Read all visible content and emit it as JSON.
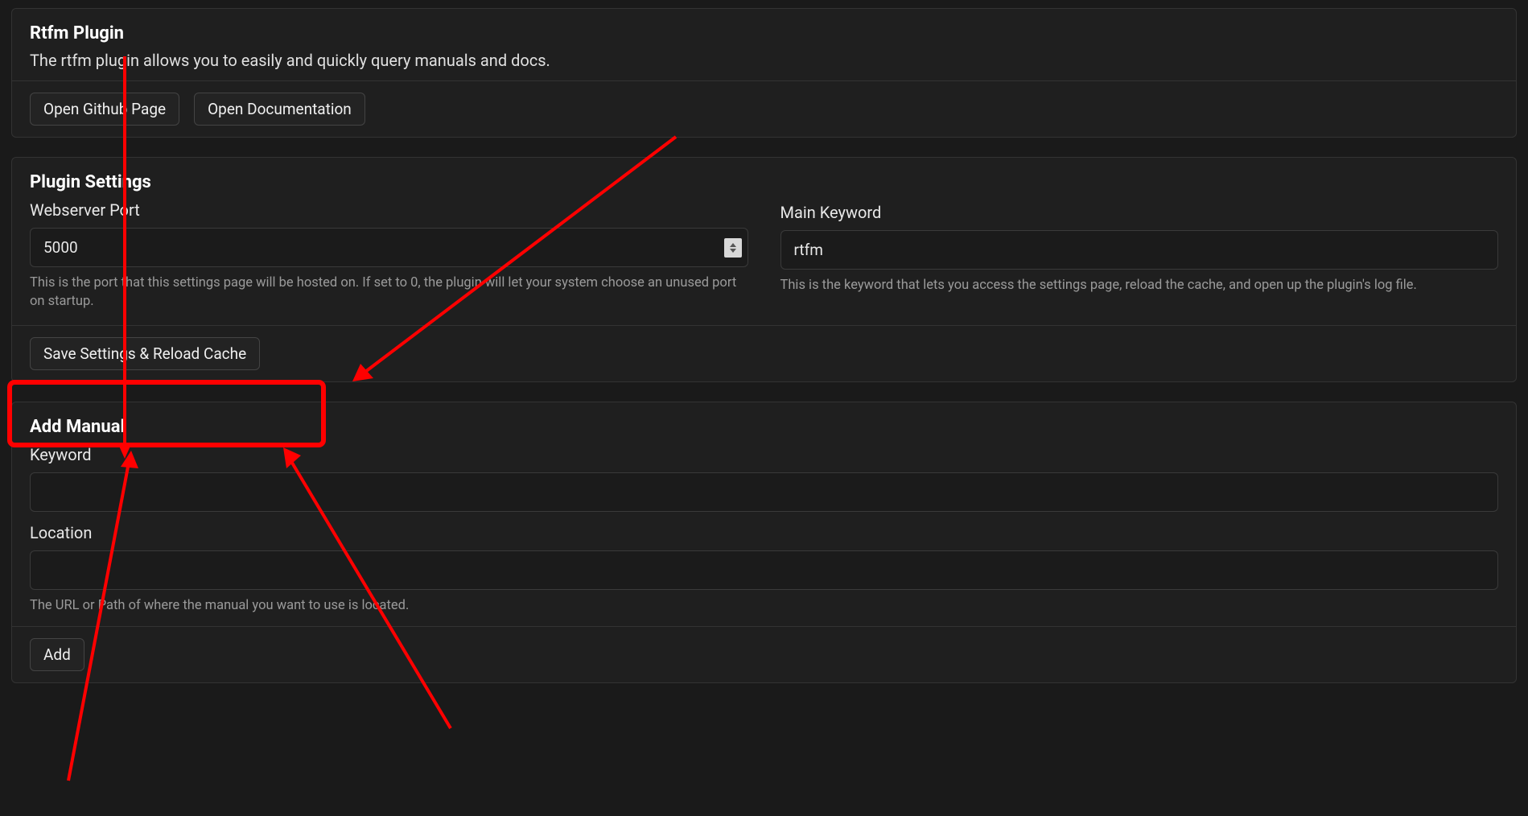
{
  "pluginInfo": {
    "title": "Rtfm Plugin",
    "description": "The rtfm plugin allows you to easily and quickly query manuals and docs.",
    "githubButton": "Open Github Page",
    "docsButton": "Open Documentation"
  },
  "settings": {
    "title": "Plugin Settings",
    "port": {
      "label": "Webserver Port",
      "value": "5000",
      "help": "This is the port that this settings page will be hosted on. If set to 0, the plugin will let your system choose an unused port on startup."
    },
    "keyword": {
      "label": "Main Keyword",
      "value": "rtfm",
      "help": "This is the keyword that lets you access the settings page, reload the cache, and open up the plugin's log file."
    },
    "saveButton": "Save Settings & Reload Cache"
  },
  "addManual": {
    "title": "Add Manual",
    "keyword": {
      "label": "Keyword",
      "value": ""
    },
    "location": {
      "label": "Location",
      "value": "",
      "help": "The URL or Path of where the manual you want to use is located."
    },
    "addButton": "Add"
  }
}
